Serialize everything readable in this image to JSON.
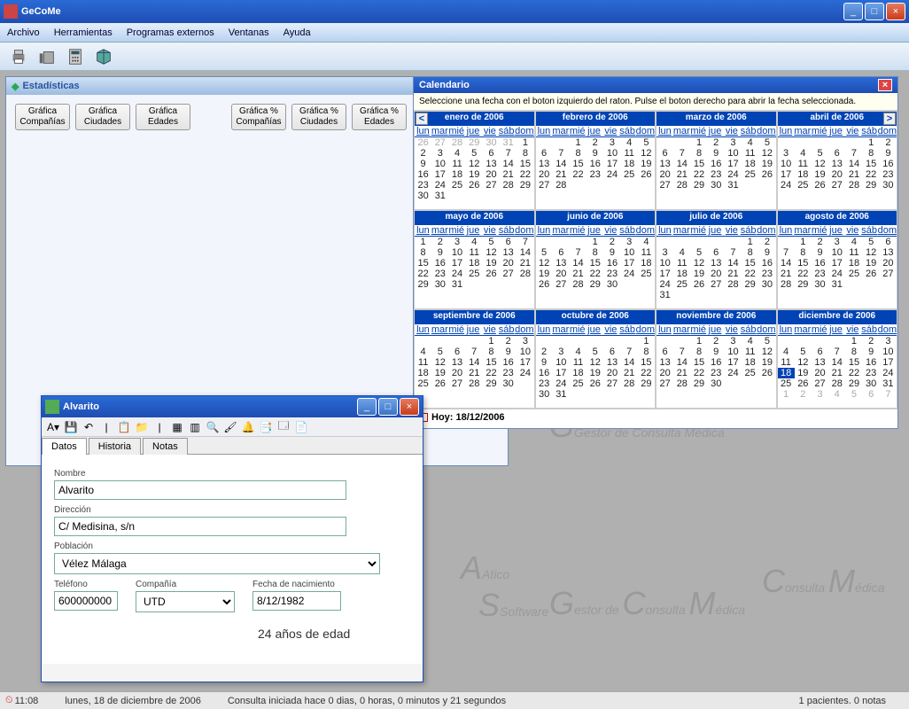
{
  "app": {
    "title": "GeCoMe"
  },
  "menu": {
    "items": [
      "Archivo",
      "Herramientas",
      "Programas externos",
      "Ventanas",
      "Ayuda"
    ]
  },
  "stats": {
    "title": "Estadísticas",
    "buttons": [
      "Gráfica Compañías",
      "Gráfica Ciudades",
      "Gráfica Edades",
      "Gráfica % Compañías",
      "Gráfica % Ciudades",
      "Gráfica % Edades"
    ]
  },
  "calendar": {
    "title": "Calendario",
    "instruction": "Seleccione una fecha con el boton izquierdo del raton. Pulse el boton derecho para abrir la fecha seleccionada.",
    "dow": [
      "lun",
      "mar",
      "mié",
      "jue",
      "vie",
      "sáb",
      "dom"
    ],
    "months": [
      {
        "name": "enero de 2006",
        "lead": 6,
        "days": 31,
        "gray": [
          26,
          27,
          28,
          29,
          30,
          31
        ]
      },
      {
        "name": "febrero de 2006",
        "lead": 2,
        "days": 28,
        "gray": []
      },
      {
        "name": "marzo de 2006",
        "lead": 2,
        "days": 31,
        "gray": []
      },
      {
        "name": "abril de 2006",
        "lead": 5,
        "days": 30,
        "gray": []
      },
      {
        "name": "mayo de 2006",
        "lead": 0,
        "days": 31,
        "gray": []
      },
      {
        "name": "junio de 2006",
        "lead": 3,
        "days": 30,
        "gray": []
      },
      {
        "name": "julio de 2006",
        "lead": 5,
        "days": 31,
        "gray": []
      },
      {
        "name": "agosto de 2006",
        "lead": 1,
        "days": 31,
        "gray": []
      },
      {
        "name": "septiembre de 2006",
        "lead": 4,
        "days": 30,
        "gray": []
      },
      {
        "name": "octubre de 2006",
        "lead": 6,
        "days": 31,
        "gray": []
      },
      {
        "name": "noviembre de 2006",
        "lead": 2,
        "days": 30,
        "gray": []
      },
      {
        "name": "diciembre de 2006",
        "lead": 4,
        "days": 31,
        "gray": [],
        "sel": 18,
        "trail": [
          1,
          2,
          3,
          4,
          5,
          6,
          7
        ]
      }
    ],
    "today_label": "Hoy: 18/12/2006"
  },
  "alvarito": {
    "title": "Alvarito",
    "tabs": [
      "Datos",
      "Historia",
      "Notas"
    ],
    "labels": {
      "nombre": "Nombre",
      "direccion": "Dirección",
      "poblacion": "Población",
      "telefono": "Teléfono",
      "compania": "Compañía",
      "fecha": "Fecha de nacimiento"
    },
    "values": {
      "nombre": "Alvarito",
      "direccion": "C/ Medisina, s/n",
      "poblacion": "Vélez Málaga",
      "telefono": "600000000",
      "compania": "UTD",
      "fecha": "8/12/1982"
    },
    "age_text": "24 años de edad"
  },
  "watermark": {
    "brand1": "Atico",
    "brand1b": "Software",
    "brand2": "Gestor de Consulta Médica"
  },
  "statusbar": {
    "time": "11:08",
    "date": "lunes, 18 de diciembre de 2006",
    "session": "Consulta iniciada hace 0 dias, 0 horas, 0 minutos y 21 segundos",
    "counts": "1 pacientes. 0 notas"
  }
}
